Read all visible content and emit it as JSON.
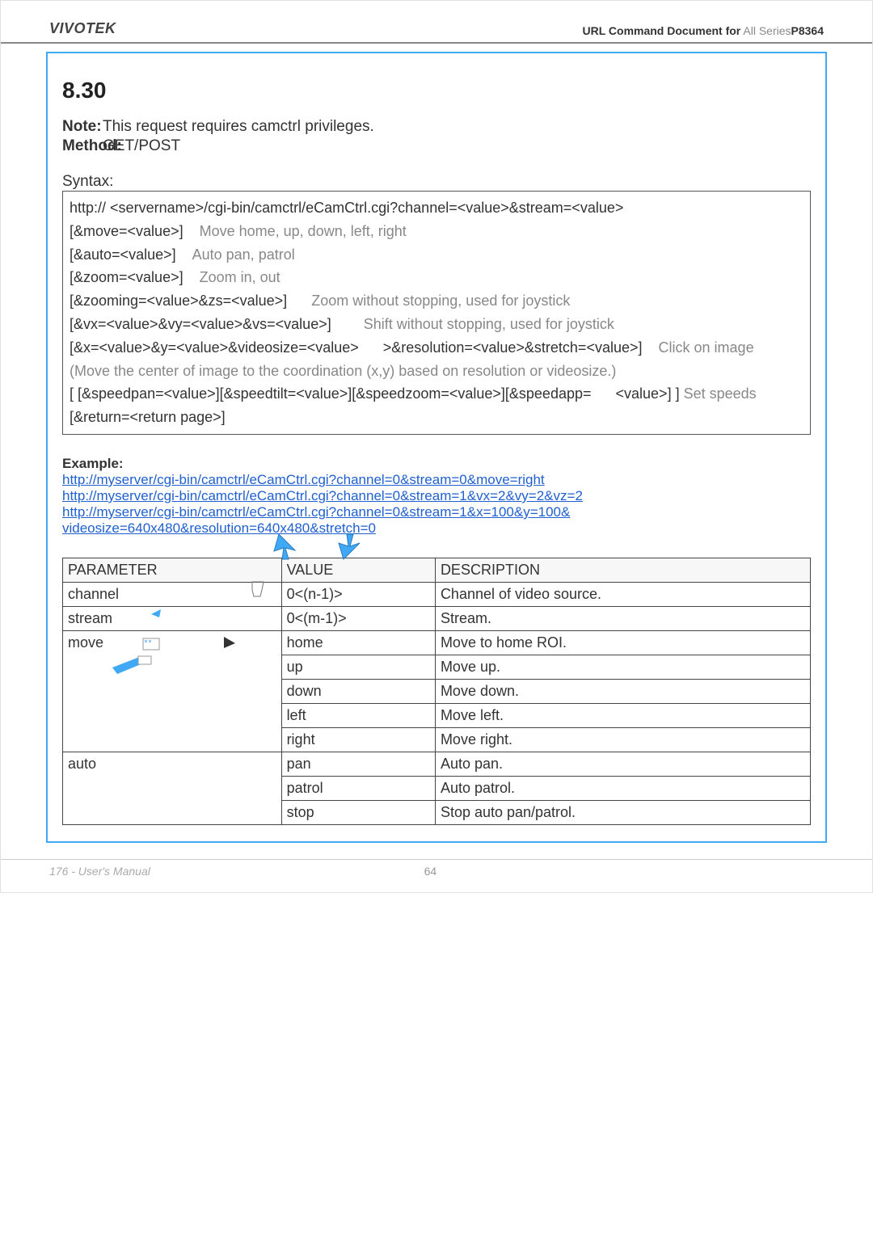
{
  "header": {
    "brand": "VIVOTEK",
    "doc_label": "URL Command Document for",
    "doc_scope": " All Series",
    "doc_model": "P8364"
  },
  "section_title": "8.30",
  "notes": {
    "note_label": "Note:",
    "note_text": "This request requires camctrl privileges.",
    "method_label": "Method:",
    "method_value": "GET/POST"
  },
  "syntax_label": "Syntax:",
  "code": {
    "l1a": "http://",
    "l1b": "<servername>/cgi-bin/camctrl/eCamCtrl.cgi?channel=<value>&stream=<value>",
    "l2a": "[&move=<value>]",
    "l2b": "Move home, up, down, left, right",
    "l3a": "[&auto=<value>]",
    "l3b": "Auto pan, patrol",
    "l4a": "[&zoom=<value>]",
    "l4b": "Zoom in, out",
    "l5a": "[&zooming=<value>&zs=<value>]",
    "l5b": "Zoom without stopping, used for joystick",
    "l6a": "[&vx=<value>&vy=<value>&vs=<value>]",
    "l6b": "Shift without stopping, used for joystick",
    "l7a": "[&x=<value>&y=<value>&videosize=<value>",
    "l7b": ">&resolution=<value>&stretch=<value>]",
    "l7c": "Click on image",
    "l8": "(Move the center of image to the coordination (x,y) based on resolution or videosize.)",
    "l9a": "[ [&speedpan=<value>][&speedtilt=<value>][&speedzoom=<value>][&speedapp=",
    "l9b": "<value>] ]",
    "l9c": "Set speeds",
    "l10": "[&return=<return page>]"
  },
  "examples": {
    "label": "Example:",
    "e1": "http://myserver/cgi-bin/camctrl/eCamCtrl.cgi?channel=0&stream=0&move=right",
    "e2": "http://myserver/cgi-bin/camctrl/eCamCtrl.cgi?channel=0&stream=1&vx=2&vy=2&vz=2",
    "e3a": "http://myserver/cgi-bin/camctrl/eCamCtrl.cgi?channel=0&stream=1&x=100&y=100&",
    "e3b": "videosize=640x480&resolution=640x480&stretch=0"
  },
  "table": {
    "headers": [
      "PARAMETER",
      "VALUE",
      "DESCRIPTION"
    ],
    "rows": [
      {
        "p": "channel",
        "v": "0<(n-1)>",
        "d": "Channel of video source."
      },
      {
        "p": "stream",
        "v": "0<(m-1)>",
        "d": "Stream."
      },
      {
        "p": "move",
        "v": "home",
        "d": "Move to home ROI."
      },
      {
        "p": "",
        "v": "up",
        "d": "Move up."
      },
      {
        "p": "",
        "v": "down",
        "d": "Move down."
      },
      {
        "p": "",
        "v": "left",
        "d": "Move left."
      },
      {
        "p": "",
        "v": "right",
        "d": "Move right."
      },
      {
        "p": "auto",
        "v": "pan",
        "d": "Auto pan."
      },
      {
        "p": "",
        "v": "patrol",
        "d": "Auto patrol."
      },
      {
        "p": "",
        "v": "stop",
        "d": "Stop auto pan/patrol."
      }
    ]
  },
  "footer": {
    "left": "176 - User's Manual",
    "center": "64"
  }
}
